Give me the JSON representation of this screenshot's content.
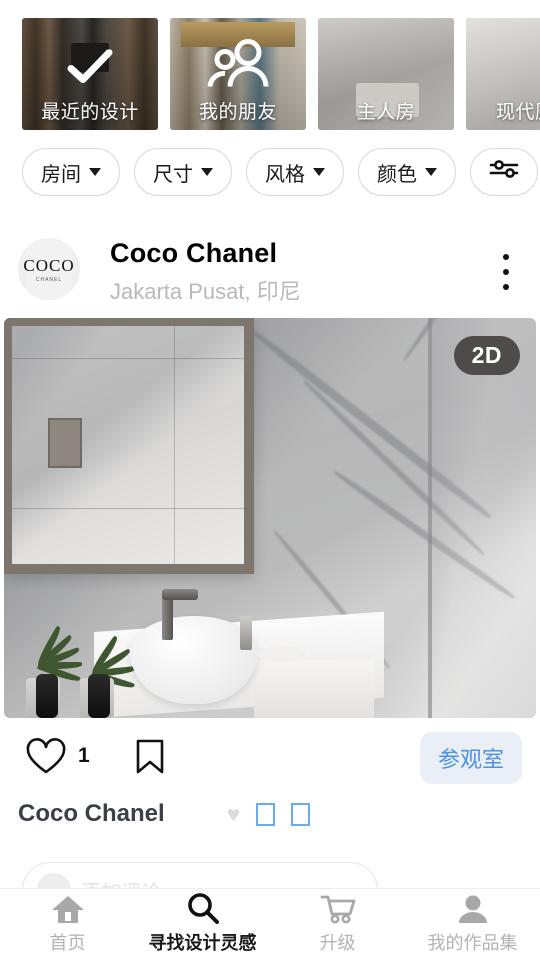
{
  "stories": [
    {
      "label": "最近的设计",
      "overlay_icon": "check-icon",
      "art": "living"
    },
    {
      "label": "我的朋友",
      "overlay_icon": "people-icon",
      "art": "friends"
    },
    {
      "label": "主人房",
      "overlay_icon": "none",
      "art": "bedroom"
    },
    {
      "label": "现代厨",
      "overlay_icon": "none",
      "art": "kitchen"
    }
  ],
  "filters": {
    "chips": [
      {
        "label": "房间"
      },
      {
        "label": "尺寸"
      },
      {
        "label": "风格"
      },
      {
        "label": "颜色"
      }
    ],
    "settings_icon": "sliders-icon"
  },
  "post": {
    "avatar_logo": "COCO",
    "avatar_logo_sub": "CHANEL",
    "user_name": "Coco Chanel",
    "location": "Jakarta Pusat, 印尼",
    "more_icon": "more-vertical-icon",
    "badge_2d": "2D",
    "like_count": "1",
    "heart_icon": "heart-outline-icon",
    "bookmark_icon": "bookmark-outline-icon",
    "visit_label": "参观室",
    "caption_title": "Coco Chanel",
    "caption_emoji": "♥",
    "comment_placeholder": "添加评论…"
  },
  "colors": {
    "accent_blue": "#4b93e8",
    "accent_blue_bg": "#e9eef7",
    "badge_bg": "#302c2a",
    "muted_text": "#b9b9b9"
  },
  "nav": {
    "items": [
      {
        "label": "首页",
        "icon": "home-icon",
        "active": false
      },
      {
        "label": "寻找设计灵感",
        "icon": "search-icon",
        "active": true
      },
      {
        "label": "升级",
        "icon": "cart-icon",
        "active": false
      },
      {
        "label": "我的作品集",
        "icon": "person-icon",
        "active": false
      }
    ]
  }
}
